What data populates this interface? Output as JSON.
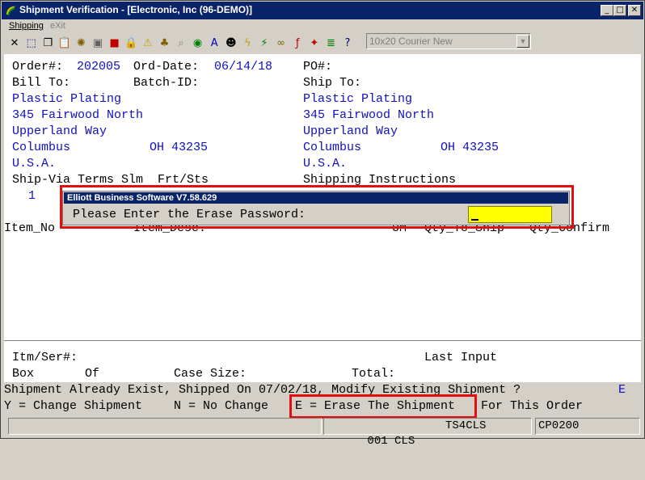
{
  "window": {
    "title": "Shipment Verification - [Electronic, Inc (96-DEMO)]",
    "min": "_",
    "max": "□",
    "close": "✕"
  },
  "menu": {
    "shipping": "Shipping",
    "exit": "eXit"
  },
  "font_select": {
    "value": "10x20 Courier New"
  },
  "toolbar": {
    "tools": [
      {
        "name": "close-x-icon",
        "glyph": "✕",
        "color": "#000"
      },
      {
        "name": "select-icon",
        "glyph": "⬚",
        "color": "#000080"
      },
      {
        "name": "copy-icon",
        "glyph": "❐",
        "color": "#000"
      },
      {
        "name": "paste-icon",
        "glyph": "📋",
        "color": "#000"
      },
      {
        "name": "settings-icon",
        "glyph": "✺",
        "color": "#806000"
      },
      {
        "name": "window-icon",
        "glyph": "▣",
        "color": "#606060"
      },
      {
        "name": "record-icon",
        "glyph": "■",
        "color": "#c00000"
      },
      {
        "name": "lock-icon",
        "glyph": "🔒",
        "color": "#000"
      },
      {
        "name": "warning-icon",
        "glyph": "⚠",
        "color": "#c0a000"
      },
      {
        "name": "group-icon",
        "glyph": "♣",
        "color": "#806000"
      },
      {
        "name": "magnify-icon",
        "glyph": "⌕",
        "color": "#808080"
      },
      {
        "name": "globe-icon",
        "glyph": "◉",
        "color": "#008000"
      },
      {
        "name": "font-a-icon",
        "glyph": "A",
        "color": "#0000c0"
      },
      {
        "name": "user-icon",
        "glyph": "☻",
        "color": "#000"
      },
      {
        "name": "lightning-icon",
        "glyph": "ϟ",
        "color": "#c0a000"
      },
      {
        "name": "flash-doc-icon",
        "glyph": "⚡",
        "color": "#008000"
      },
      {
        "name": "link-icon",
        "glyph": "∞",
        "color": "#806000"
      },
      {
        "name": "function-icon",
        "glyph": "ƒ",
        "color": "#c00000"
      },
      {
        "name": "sparkle-icon",
        "glyph": "✦",
        "color": "#c00000"
      },
      {
        "name": "notes-icon",
        "glyph": "≣",
        "color": "#008000"
      },
      {
        "name": "help-icon",
        "glyph": "?",
        "color": "#000080"
      }
    ]
  },
  "order": {
    "order_label": "Order#:",
    "order_no": "202005",
    "orddate_label": "Ord-Date:",
    "ord_date": "06/14/18",
    "po_label": "PO#:",
    "billto_label": "Bill To:",
    "batch_label": "Batch-ID:",
    "shipto_label": "Ship To:",
    "bill": {
      "name": "Plastic Plating",
      "addr1": "345 Fairwood North",
      "addr2": "Upperland Way",
      "city": "Columbus",
      "state_zip": "OH 43235",
      "country": "U.S.A."
    },
    "ship": {
      "name": "Plastic Plating",
      "addr1": "345 Fairwood North",
      "addr2": "Upperland Way",
      "city": "Columbus",
      "state_zip": "OH 43235",
      "country": "U.S.A."
    },
    "shipvia_header": "Ship-Via Terms Slm  Frt/Sts",
    "shipinstr_label": "Shipping Instructions",
    "shipvia_value": "1"
  },
  "items": {
    "col_item": "Item_No",
    "col_desc": "Item_Desc.",
    "col_um": "UM",
    "col_qty_ship": "Qty_To_Ship",
    "col_qty_confirm": "Qty_Confirm"
  },
  "footer": {
    "itm_ser": "Itm/Ser#:",
    "last_input": "Last Input",
    "box": "Box",
    "of": "Of",
    "case_size": "Case Size:",
    "total": "Total:",
    "message": "Shipment Already Exist, Shipped On 07/02/18, Modify Existing Shipment ?",
    "input_char": "E",
    "opt_y": "Y = Change Shipment",
    "opt_n": "N = No Change",
    "opt_e": "E = Erase The Shipment",
    "opt_suffix": "For This Order"
  },
  "dialog": {
    "title": "Elliott Business Software V7.58.629",
    "prompt": "Please Enter the Erase Password:",
    "password": ""
  },
  "statusbar": {
    "cell2": "001 CLS",
    "cell3": "TS4CLS",
    "cell4": "CP0200"
  }
}
